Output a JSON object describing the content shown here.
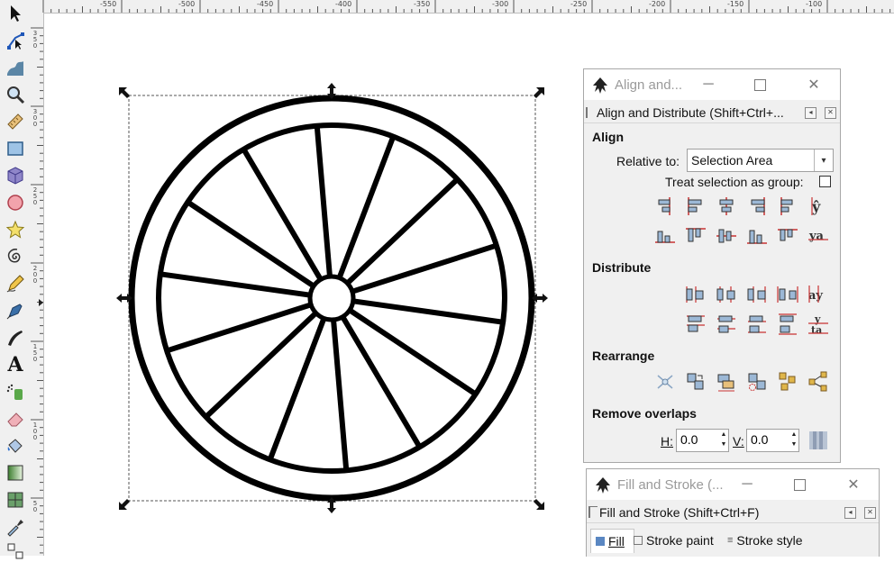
{
  "toolbar": {
    "tools": [
      "selector-tool-icon",
      "node-tool-icon",
      "tweak-tool-icon",
      "zoom-tool-icon",
      "measure-tool-icon",
      "rectangle-tool-icon",
      "box3d-tool-icon",
      "ellipse-tool-icon",
      "star-tool-icon",
      "spiral-tool-icon",
      "pencil-tool-icon",
      "pen-tool-icon",
      "calligraphy-tool-icon",
      "text-tool-icon",
      "spray-tool-icon",
      "eraser-tool-icon",
      "paint-bucket-tool-icon",
      "gradient-tool-icon",
      "mesh-tool-icon",
      "dropper-tool-icon",
      "connector-tool-icon"
    ],
    "text_tool_glyph": "A"
  },
  "ruler": {
    "top_labels": [
      "-550",
      "-500",
      "-450",
      "-400",
      "-350",
      "-300",
      "-250",
      "-200",
      "-150",
      "-100"
    ],
    "left_labels": [
      "350",
      "300",
      "250",
      "200",
      "150",
      "100",
      "50"
    ]
  },
  "align_dialog": {
    "window_title": "Align and...",
    "header": "Align and Distribute (Shift+Ctrl+...",
    "align_heading": "Align",
    "relative_to_label": "Relative to:",
    "relative_to_value": "Selection Area",
    "treat_group_label": "Treat selection as group:",
    "treat_group_checked": false,
    "distribute_heading": "Distribute",
    "rearrange_heading": "Rearrange",
    "remove_overlaps_heading": "Remove overlaps",
    "h_label": "H:",
    "h_value": "0.0",
    "v_label": "V:",
    "v_value": "0.0"
  },
  "fill_dialog": {
    "window_title": "Fill and Stroke (...",
    "header": "Fill and Stroke (Shift+Ctrl+F)",
    "tabs": [
      "Fill",
      "Stroke paint",
      "Stroke style"
    ]
  },
  "colors": {
    "accent": "#c83232",
    "selection": "#555555",
    "drawing": "#000000"
  }
}
